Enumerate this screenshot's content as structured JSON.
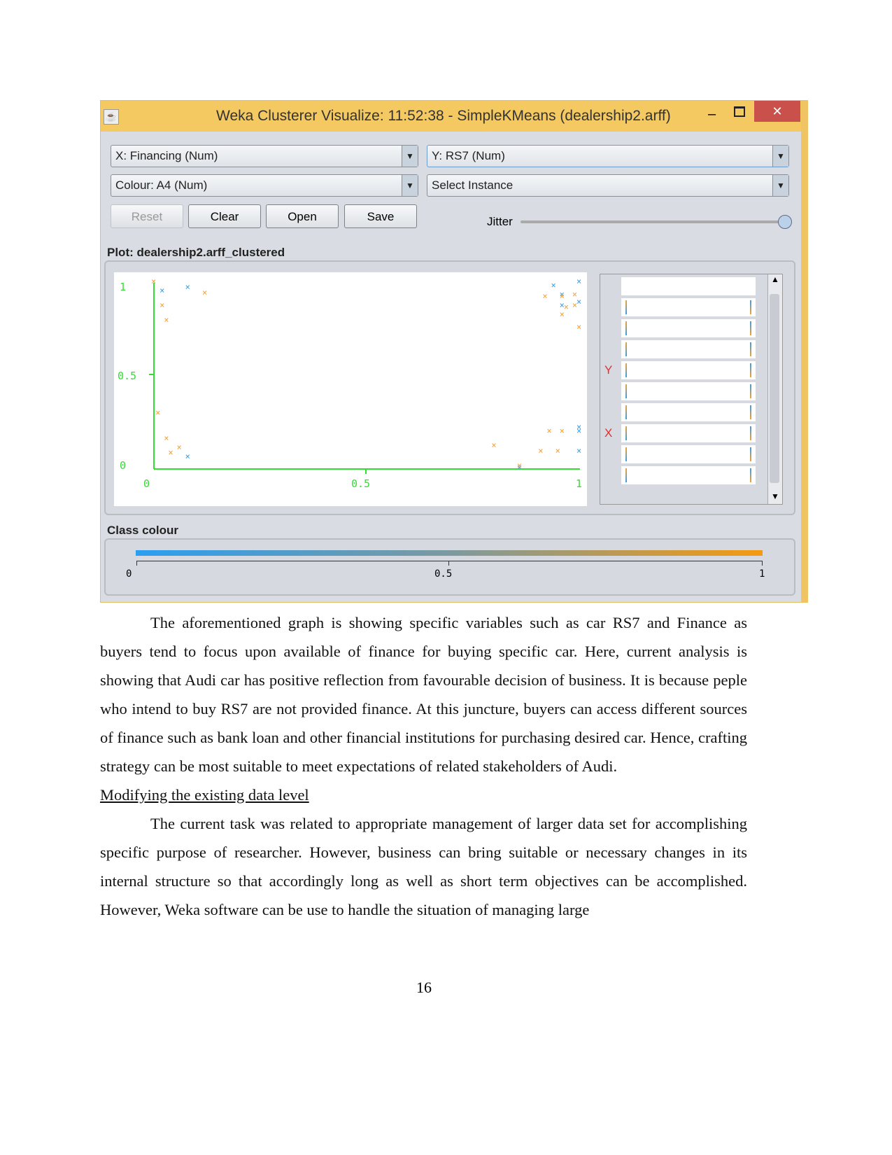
{
  "window": {
    "title": "Weka Clusterer Visualize: 11:52:38 - SimpleKMeans (dealership2.arff)",
    "close": "✕",
    "minimize": "–"
  },
  "controls": {
    "x_axis": "X: Financing (Num)",
    "y_axis": "Y: RS7 (Num)",
    "colour": "Colour: A4 (Num)",
    "select_instance": "Select Instance",
    "reset": "Reset",
    "clear": "Clear",
    "open": "Open",
    "save": "Save",
    "jitter": "Jitter",
    "jitter_value": 1.0
  },
  "plot_label": "Plot: dealership2.arff_clustered",
  "class_colour_label": "Class colour",
  "chart_data": {
    "type": "scatter",
    "xlim": [
      0,
      1
    ],
    "ylim": [
      0,
      1
    ],
    "x_ticks": [
      "0",
      "0.5",
      "1"
    ],
    "y_ticks": [
      "0",
      "0.5",
      "1"
    ],
    "colors": {
      "axis": "#33dd33",
      "blue": "#3a9ee6",
      "orange": "#f4a034"
    },
    "points": [
      {
        "x": 0.0,
        "y": 1.03,
        "c": "orange"
      },
      {
        "x": 0.02,
        "y": 0.98,
        "c": "blue"
      },
      {
        "x": 0.08,
        "y": 1.0,
        "c": "blue"
      },
      {
        "x": 0.12,
        "y": 0.97,
        "c": "orange"
      },
      {
        "x": 0.02,
        "y": 0.9,
        "c": "orange"
      },
      {
        "x": 0.03,
        "y": 0.82,
        "c": "orange"
      },
      {
        "x": 0.01,
        "y": 0.31,
        "c": "orange"
      },
      {
        "x": 0.03,
        "y": 0.17,
        "c": "orange"
      },
      {
        "x": 0.04,
        "y": 0.09,
        "c": "orange"
      },
      {
        "x": 0.06,
        "y": 0.12,
        "c": "orange"
      },
      {
        "x": 0.08,
        "y": 0.07,
        "c": "blue"
      },
      {
        "x": 0.8,
        "y": 0.13,
        "c": "orange"
      },
      {
        "x": 0.86,
        "y": 0.01,
        "c": "blue"
      },
      {
        "x": 0.86,
        "y": 0.02,
        "c": "orange"
      },
      {
        "x": 0.91,
        "y": 0.1,
        "c": "orange"
      },
      {
        "x": 0.95,
        "y": 0.1,
        "c": "orange"
      },
      {
        "x": 1.0,
        "y": 0.1,
        "c": "blue"
      },
      {
        "x": 0.93,
        "y": 0.21,
        "c": "orange"
      },
      {
        "x": 0.96,
        "y": 0.21,
        "c": "orange"
      },
      {
        "x": 1.0,
        "y": 0.23,
        "c": "blue"
      },
      {
        "x": 1.0,
        "y": 0.21,
        "c": "blue"
      },
      {
        "x": 0.94,
        "y": 1.01,
        "c": "blue"
      },
      {
        "x": 1.0,
        "y": 1.03,
        "c": "blue"
      },
      {
        "x": 0.92,
        "y": 0.95,
        "c": "orange"
      },
      {
        "x": 0.96,
        "y": 0.96,
        "c": "blue"
      },
      {
        "x": 0.96,
        "y": 0.95,
        "c": "orange"
      },
      {
        "x": 0.96,
        "y": 0.9,
        "c": "blue"
      },
      {
        "x": 0.96,
        "y": 0.85,
        "c": "orange"
      },
      {
        "x": 0.97,
        "y": 0.89,
        "c": "orange"
      },
      {
        "x": 0.99,
        "y": 0.96,
        "c": "orange"
      },
      {
        "x": 0.99,
        "y": 0.9,
        "c": "orange"
      },
      {
        "x": 1.0,
        "y": 0.92,
        "c": "blue"
      },
      {
        "x": 1.0,
        "y": 0.78,
        "c": "orange"
      }
    ],
    "side_labels": {
      "y": "Y",
      "x": "X"
    },
    "colour_scale": {
      "ticks": [
        "0",
        "0.5",
        "1"
      ],
      "from": "#2a9ef0",
      "to": "#f59a10"
    }
  },
  "doc": {
    "para1": "The aforementioned graph is showing specific variables such as car RS7 and Finance as buyers tend to focus upon available of finance for buying specific car. Here, current analysis is showing that Audi car has positive reflection from favourable decision of business. It is because peple who intend to buy RS7 are not provided finance. At this juncture, buyers can access different sources of finance such as bank loan and other financial institutions for purchasing desired car. Hence, crafting strategy can be most suitable to meet expectations of related stakeholders of Audi.",
    "heading": "Modifying the existing data level",
    "para2": "The current task was related to appropriate management of larger data set for accomplishing specific purpose of researcher. However, business can bring suitable or necessary changes in its internal structure so that accordingly long as well as short term objectives can be accomplished. However, Weka software can be use to handle the situation of managing large",
    "page_number": "16"
  }
}
